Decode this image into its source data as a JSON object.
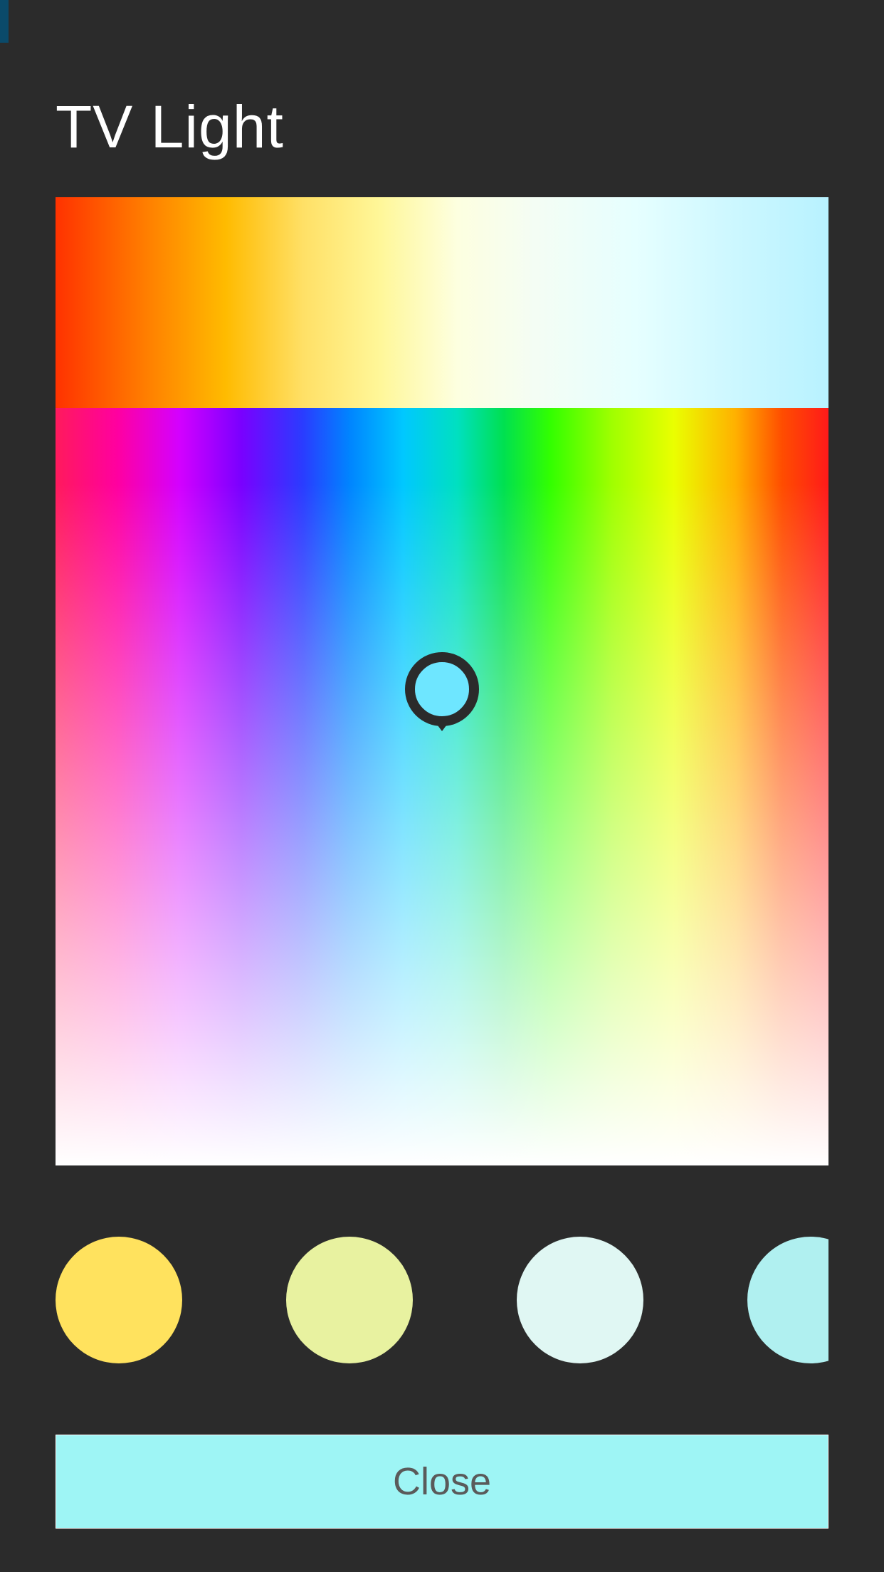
{
  "title": "TV Light",
  "picker": {
    "selected_color": "#6ee6ff",
    "handle_stroke": "#2b2b2b"
  },
  "swatches": [
    {
      "color": "#ffe25e"
    },
    {
      "color": "#e8f2a0"
    },
    {
      "color": "#e0f7f3"
    },
    {
      "color": "#b0f0f0"
    },
    {
      "color": "#e895f0"
    }
  ],
  "close_button": {
    "label": "Close",
    "bg": "#9ef5f5"
  }
}
